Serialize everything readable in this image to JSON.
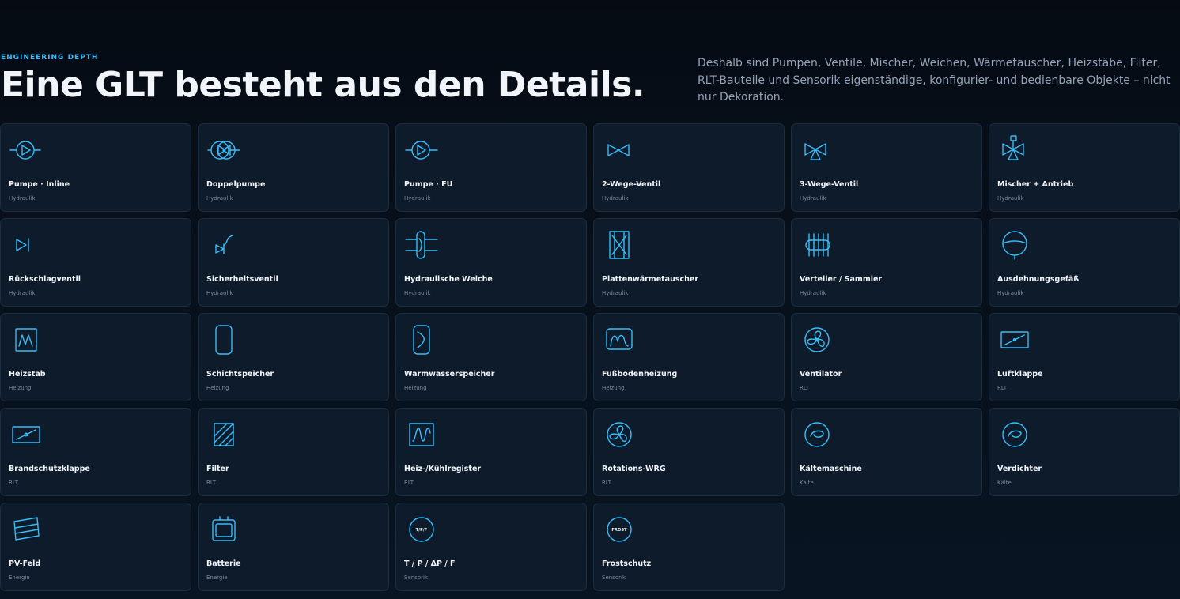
{
  "header": {
    "eyebrow": "ENGINEERING DEPTH",
    "title": "Eine GLT besteht aus den Details.",
    "lead": "Deshalb sind Pumpen, Ventile, Mischer, Weichen, Wärmetauscher, Heizstäbe, Filter, RLT-Bauteile und Sensorik eigenständige, konfigurier- und bedienbare Objekte – nicht nur Dekoration."
  },
  "accent_color": "#38bdf8",
  "components": [
    {
      "label": "Pumpe · Inline",
      "category": "Hydraulik",
      "icon": "pump-icon"
    },
    {
      "label": "Doppelpumpe",
      "category": "Hydraulik",
      "icon": "double-pump-icon"
    },
    {
      "label": "Pumpe · FU",
      "category": "Hydraulik",
      "icon": "pump-vfd-icon"
    },
    {
      "label": "2-Wege-Ventil",
      "category": "Hydraulik",
      "icon": "two-way-valve-icon"
    },
    {
      "label": "3-Wege-Ventil",
      "category": "Hydraulik",
      "icon": "three-way-valve-icon"
    },
    {
      "label": "Mischer + Antrieb",
      "category": "Hydraulik",
      "icon": "mixer-actuator-icon"
    },
    {
      "label": "Rückschlagventil",
      "category": "Hydraulik",
      "icon": "check-valve-icon"
    },
    {
      "label": "Sicherheitsventil",
      "category": "Hydraulik",
      "icon": "safety-valve-icon"
    },
    {
      "label": "Hydraulische Weiche",
      "category": "Hydraulik",
      "icon": "hydraulic-separator-icon"
    },
    {
      "label": "Plattenwärmetauscher",
      "category": "Hydraulik",
      "icon": "plate-heat-exchanger-icon"
    },
    {
      "label": "Verteiler / Sammler",
      "category": "Hydraulik",
      "icon": "manifold-icon"
    },
    {
      "label": "Ausdehnungsgefäß",
      "category": "Hydraulik",
      "icon": "expansion-vessel-icon"
    },
    {
      "label": "Heizstab",
      "category": "Heizung",
      "icon": "heating-rod-icon"
    },
    {
      "label": "Schichtspeicher",
      "category": "Heizung",
      "icon": "buffer-tank-icon"
    },
    {
      "label": "Warmwasserspeicher",
      "category": "Heizung",
      "icon": "hot-water-tank-icon"
    },
    {
      "label": "Fußbodenheizung",
      "category": "Heizung",
      "icon": "floor-heating-icon"
    },
    {
      "label": "Ventilator",
      "category": "RLT",
      "icon": "fan-icon"
    },
    {
      "label": "Luftklappe",
      "category": "RLT",
      "icon": "air-damper-icon"
    },
    {
      "label": "Brandschutzklappe",
      "category": "RLT",
      "icon": "fire-damper-icon"
    },
    {
      "label": "Filter",
      "category": "RLT",
      "icon": "filter-icon"
    },
    {
      "label": "Heiz-/Kühlregister",
      "category": "RLT",
      "icon": "coil-icon"
    },
    {
      "label": "Rotations-WRG",
      "category": "RLT",
      "icon": "rotary-heat-recovery-icon"
    },
    {
      "label": "Kältemaschine",
      "category": "Kälte",
      "icon": "chiller-icon"
    },
    {
      "label": "Verdichter",
      "category": "Kälte",
      "icon": "compressor-icon"
    },
    {
      "label": "PV-Feld",
      "category": "Energie",
      "icon": "pv-array-icon"
    },
    {
      "label": "Batterie",
      "category": "Energie",
      "icon": "battery-icon"
    },
    {
      "label": "T / P / ΔP / F",
      "category": "Sensorik",
      "icon": "sensor-icon",
      "badge": "T/P/F"
    },
    {
      "label": "Frostschutz",
      "category": "Sensorik",
      "icon": "frost-sensor-icon",
      "badge": "FROST"
    }
  ]
}
